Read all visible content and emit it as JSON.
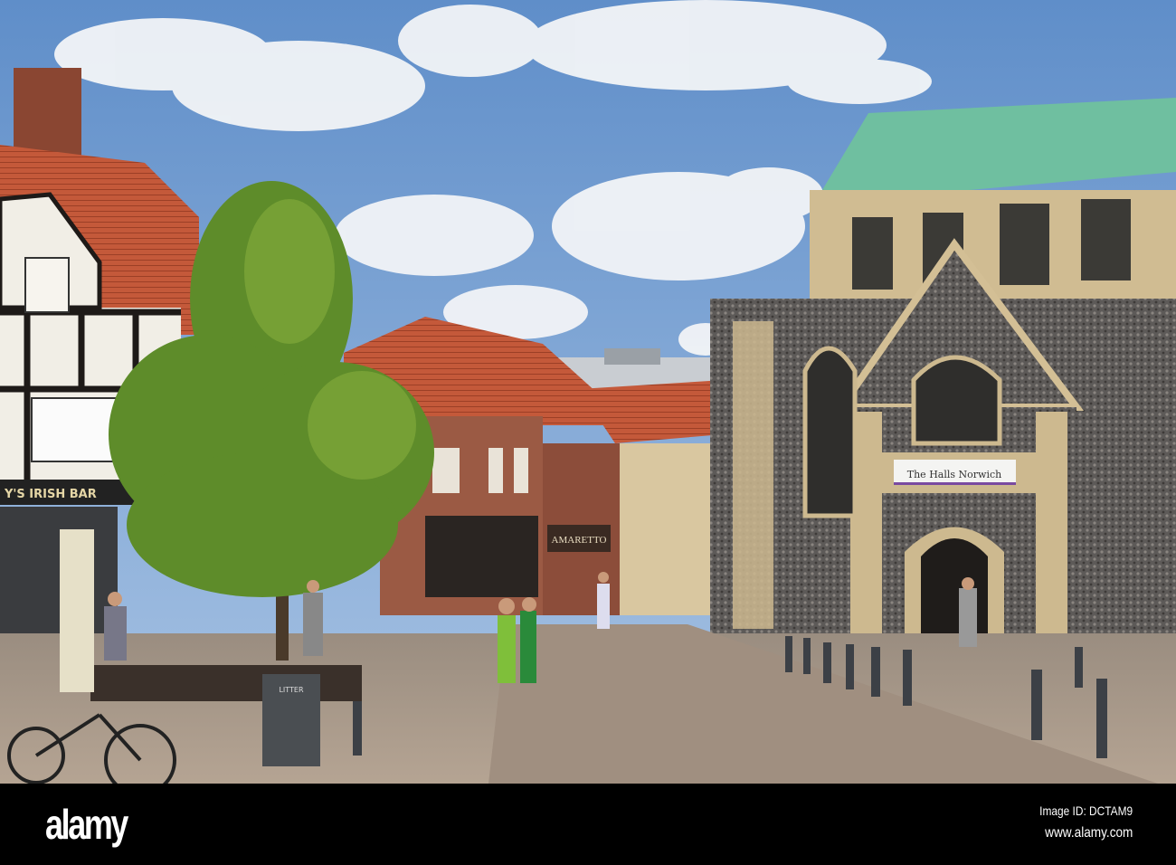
{
  "photo": {
    "church_sign": "The Halls Norwich",
    "pub_sign": "Y'S IRISH BAR",
    "shop_sign": "AMARETTO",
    "bin_label": "LITTER"
  },
  "footer": {
    "logo": "alamy",
    "image_id": "Image ID: DCTAM9",
    "website": "www.alamy.com"
  }
}
